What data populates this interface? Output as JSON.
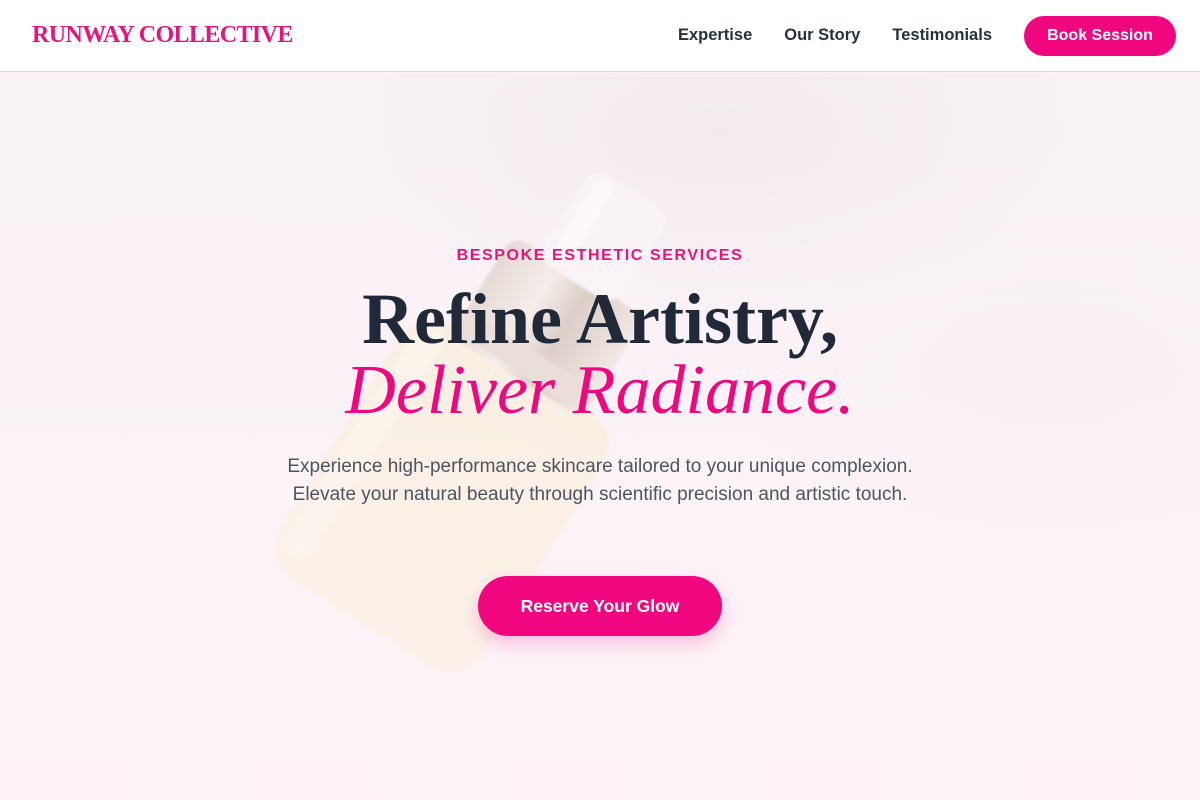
{
  "header": {
    "logo": "RUNWAY COLLECTIVE",
    "nav": [
      {
        "label": "Expertise"
      },
      {
        "label": "Our Story"
      },
      {
        "label": "Testimonials"
      }
    ],
    "book_button": "Book Session"
  },
  "hero": {
    "eyebrow": "BESPOKE ESTHETIC SERVICES",
    "headline_line1": "Refine Artistry,",
    "headline_line2": "Deliver Radiance.",
    "lead": "Experience high-performance skincare tailored to your unique complexion. Elevate your natural beauty through scientific precision and artistic touch.",
    "cta": "Reserve Your Glow",
    "background_image": "serum-bottle-photo"
  },
  "colors": {
    "accent": "#f0077f",
    "heading": "#1f2937",
    "body_text": "#4b5563",
    "nav_text": "#26303f",
    "hero_background": "#fdf2f6"
  }
}
